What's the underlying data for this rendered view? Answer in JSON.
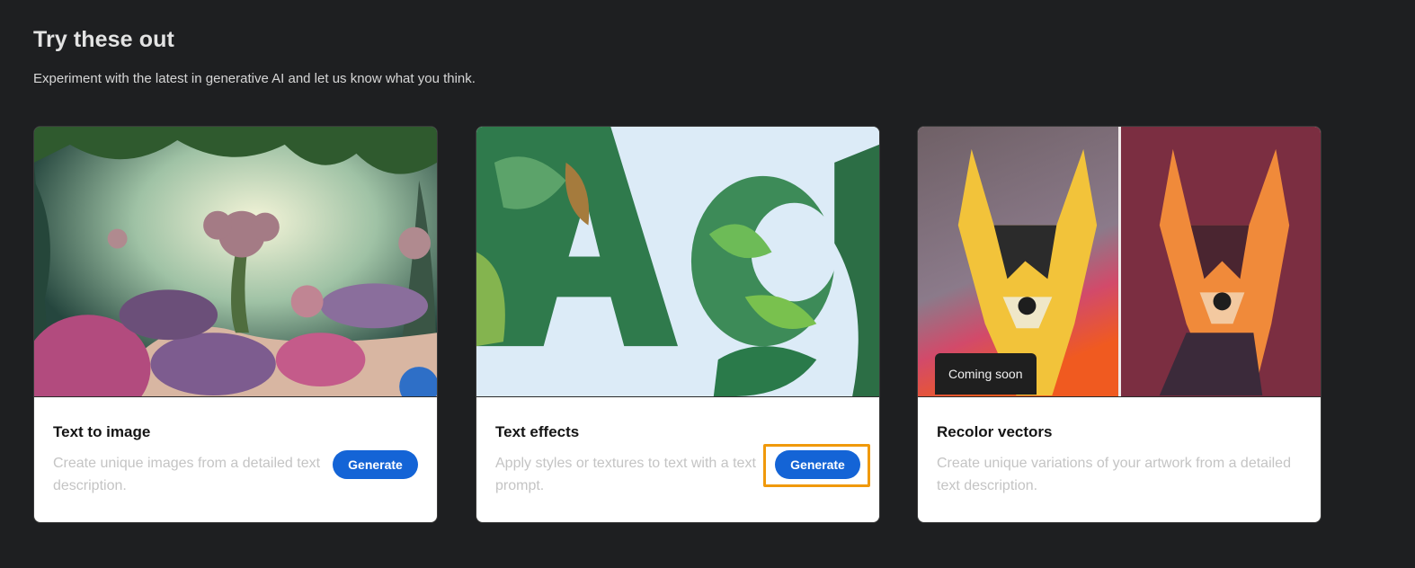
{
  "section": {
    "title": "Try these out",
    "subtitle": "Experiment with the latest in generative AI and let us know what you think."
  },
  "cards": [
    {
      "title": "Text to image",
      "description": "Create unique images from a detailed text description.",
      "button_label": "Generate",
      "image": "fantasy-garden-illustration"
    },
    {
      "title": "Text effects",
      "description": "Apply styles or textures to text with a text prompt.",
      "button_label": "Generate",
      "image": "leafy-letters-illustration",
      "focused": true
    },
    {
      "title": "Recolor vectors",
      "description": "Create unique variations of your artwork from a detailed text description.",
      "badge": "Coming soon",
      "image": "geometric-dog-illustration"
    }
  ],
  "colors": {
    "background": "#1e1f21",
    "button": "#1464d6",
    "focus_ring": "#f0990b"
  }
}
